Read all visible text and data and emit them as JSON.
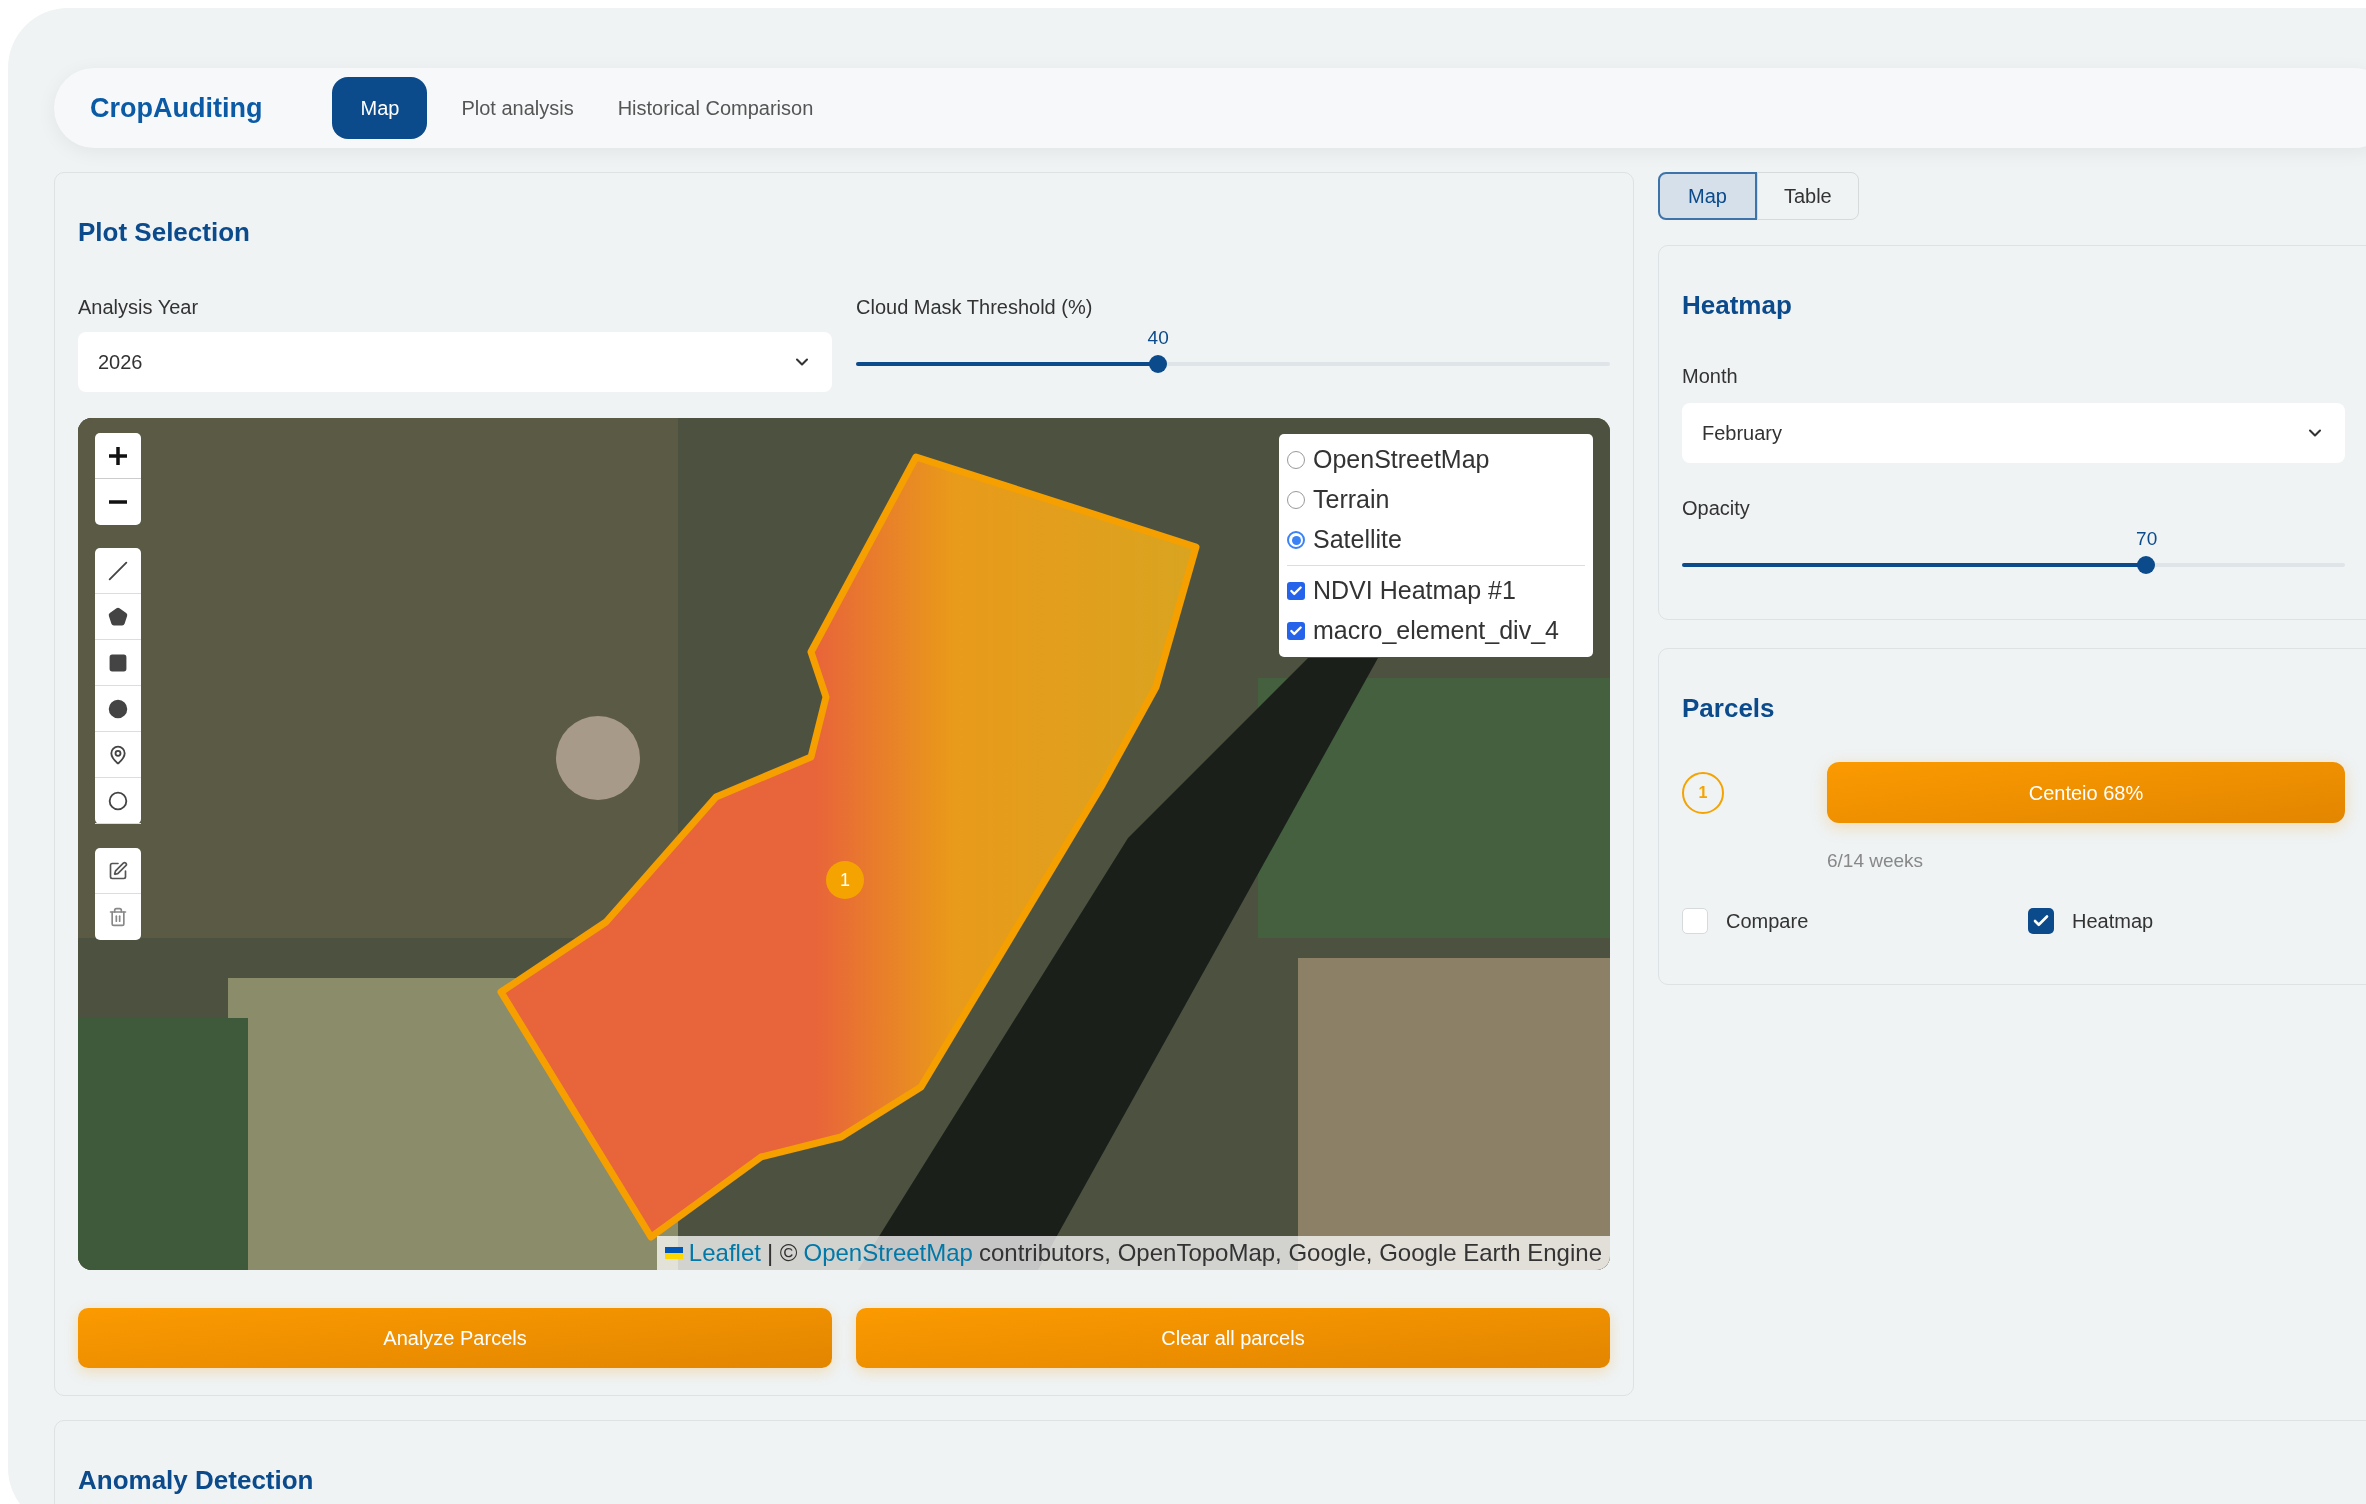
{
  "nav": {
    "brand": "CropAuditing",
    "tabs": [
      {
        "label": "Map",
        "selected": true
      },
      {
        "label": "Plot analysis",
        "selected": false
      },
      {
        "label": "Historical Comparison",
        "selected": false
      }
    ]
  },
  "plot_selection": {
    "title": "Plot Selection",
    "analysis_year": {
      "label": "Analysis Year",
      "value": "2026"
    },
    "cloud_mask": {
      "label": "Cloud Mask Threshold (%)",
      "reading": "40",
      "level": 0.4
    }
  },
  "map": {
    "base_layers": [
      {
        "label": "OpenStreetMap",
        "selected": false
      },
      {
        "label": "Terrain",
        "selected": false
      },
      {
        "label": "Satellite",
        "selected": true
      }
    ],
    "overlays": [
      {
        "label": "NDVI Heatmap #1",
        "checked": true
      },
      {
        "label": "macro_element_div_4",
        "checked": true
      }
    ],
    "parcel_marker": "1",
    "attribution": {
      "leaflet": "Leaflet",
      "separator": "| ©",
      "osm": "OpenStreetMap",
      "rest": "contributors, OpenTopoMap, Google, Google Earth Engine"
    }
  },
  "actions": [
    "Analyze Parcels",
    "Clear all parcels"
  ],
  "view_tabs": [
    {
      "label": "Map",
      "selected": true
    },
    {
      "label": "Table",
      "selected": false
    }
  ],
  "heatmap": {
    "title": "Heatmap",
    "month": {
      "label": "Month",
      "value": "February"
    },
    "opacity": {
      "label": "Opacity",
      "reading": "70",
      "level": 0.7
    }
  },
  "parcels": {
    "title": "Parcels",
    "items": [
      {
        "number": "1",
        "label": "Centeio 68%",
        "weeks": "6/14 weeks"
      }
    ],
    "options": [
      {
        "label": "Compare",
        "checked": false
      },
      {
        "label": "Heatmap",
        "checked": true
      }
    ]
  },
  "anomaly": {
    "title": "Anomaly Detection"
  }
}
